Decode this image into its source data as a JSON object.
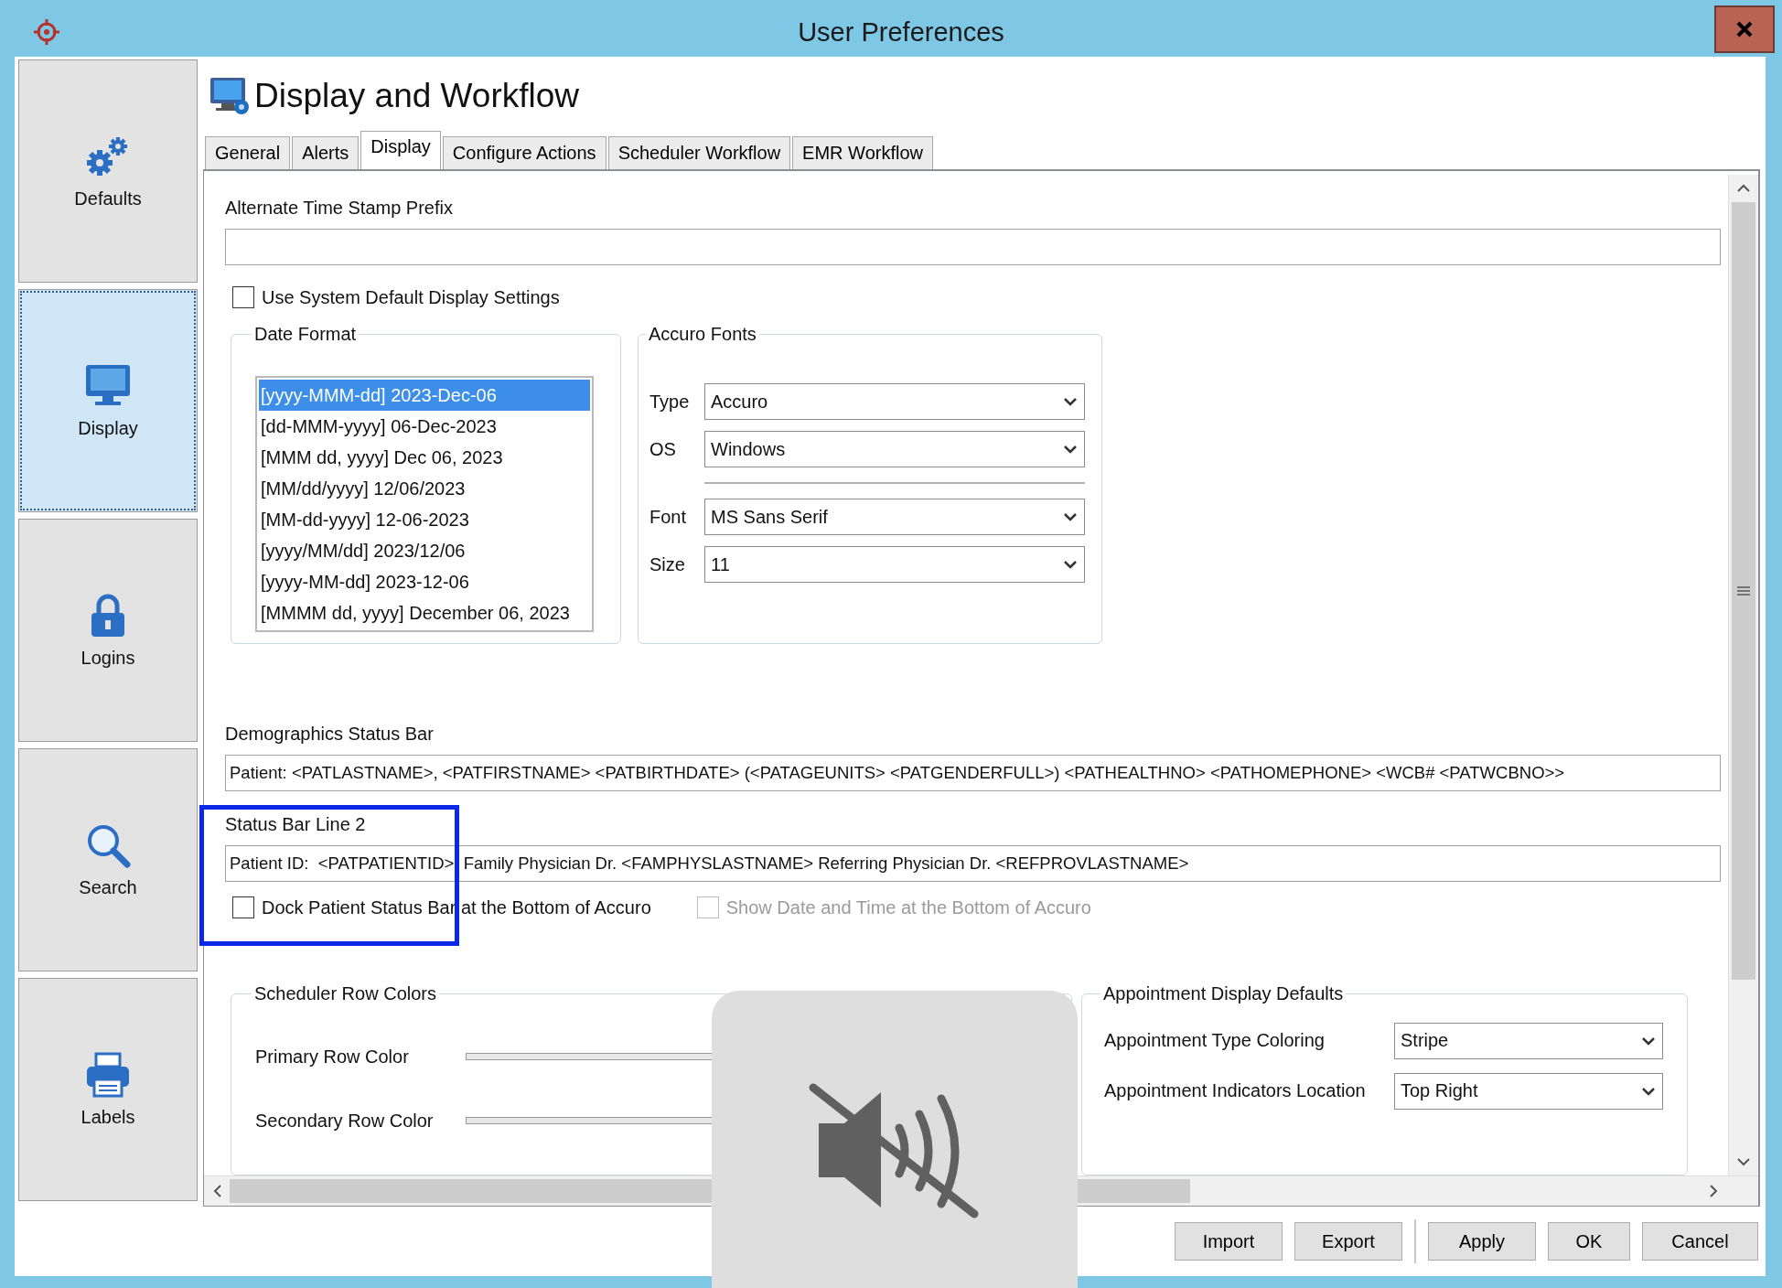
{
  "window": {
    "title": "User Preferences"
  },
  "sidebar": {
    "items": [
      {
        "label": "Defaults",
        "kind": "gears",
        "selected": false
      },
      {
        "label": "Display",
        "kind": "monitor",
        "selected": true
      },
      {
        "label": "Logins",
        "kind": "lock",
        "selected": false
      },
      {
        "label": "Search",
        "kind": "search",
        "selected": false
      },
      {
        "label": "Labels",
        "kind": "printer",
        "selected": false
      }
    ]
  },
  "header": {
    "title": "Display and Workflow"
  },
  "tabs": [
    {
      "label": "General",
      "selected": false
    },
    {
      "label": "Alerts",
      "selected": false
    },
    {
      "label": "Display",
      "selected": true
    },
    {
      "label": "Configure Actions",
      "selected": false
    },
    {
      "label": "Scheduler Workflow",
      "selected": false
    },
    {
      "label": "EMR Workflow",
      "selected": false
    }
  ],
  "form": {
    "timestamp_prefix": {
      "label": "Alternate Time Stamp Prefix"
    },
    "use_system_default": {
      "label": "Use System Default Display Settings",
      "checked": false
    },
    "date_format": {
      "title": "Date Format",
      "options": [
        {
          "label": "[yyyy-MMM-dd] 2023-Dec-06",
          "selected": true
        },
        {
          "label": "[dd-MMM-yyyy] 06-Dec-2023",
          "selected": false
        },
        {
          "label": "[MMM dd, yyyy] Dec 06, 2023",
          "selected": false
        },
        {
          "label": "[MM/dd/yyyy] 12/06/2023",
          "selected": false
        },
        {
          "label": "[MM-dd-yyyy] 12-06-2023",
          "selected": false
        },
        {
          "label": "[yyyy/MM/dd] 2023/12/06",
          "selected": false
        },
        {
          "label": "[yyyy-MM-dd] 2023-12-06",
          "selected": false
        },
        {
          "label": "[MMMM dd, yyyy] December 06, 2023",
          "selected": false
        }
      ]
    },
    "fonts": {
      "title": "Accuro Fonts",
      "system": [
        {
          "label": "Type",
          "value": "Accuro"
        },
        {
          "label": "OS",
          "value": "Windows"
        }
      ],
      "font": [
        {
          "label": "Font",
          "value": "MS Sans Serif"
        },
        {
          "label": "Size",
          "value": "11"
        }
      ]
    },
    "demographics_bar": {
      "label": "Demographics Status Bar",
      "value": "Patient: <PATLASTNAME>, <PATFIRSTNAME> <PATBIRTHDATE> (<PATAGEUNITS> <PATGENDERFULL>) <PATHEALTHNO> <PATHOMEPHONE> <WCB# <PATWCBNO>>"
    },
    "status_line_2": {
      "label": "Status Bar Line 2",
      "value": "Patient ID:  <PATPATIENTID>  Family Physician Dr. <FAMPHYSLASTNAME> Referring Physician Dr. <REFPROVLASTNAME>"
    },
    "options": [
      {
        "label": "Dock Patient Status Bar at the Bottom of Accuro",
        "checked": false,
        "disabled": false
      },
      {
        "label": "Show Date and Time at the Bottom of Accuro",
        "checked": false,
        "disabled": true
      }
    ],
    "scheduler_colors": {
      "title": "Scheduler Row Colors",
      "rows": [
        {
          "label": "Primary Row Color"
        },
        {
          "label": "Secondary Row Color"
        }
      ]
    },
    "appointment_defaults": {
      "title": "Appointment Display Defaults",
      "fields": [
        {
          "label": "Appointment Type Coloring",
          "value": "Stripe"
        },
        {
          "label": "Appointment Indicators Location",
          "value": "Top Right"
        }
      ]
    }
  },
  "buttons": {
    "left": [
      "Import",
      "Export"
    ],
    "right": [
      "Apply",
      "OK",
      "Cancel"
    ]
  },
  "highlight": {
    "kind": "box"
  },
  "overlay": {
    "kind": "mute"
  }
}
